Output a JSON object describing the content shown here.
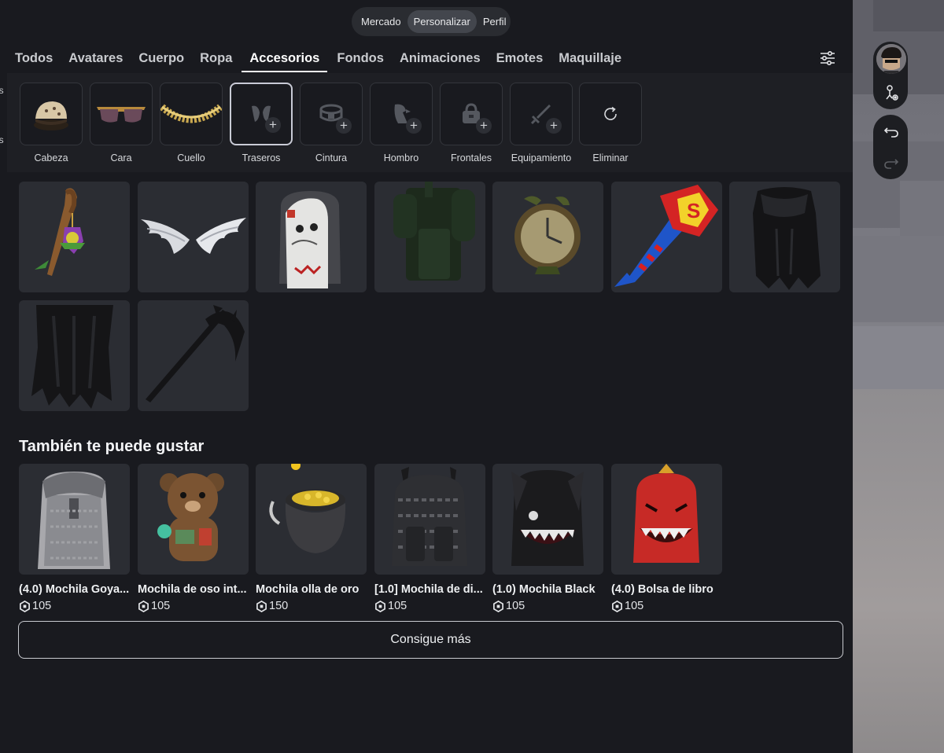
{
  "top_switch": {
    "items": [
      "Mercado",
      "Personalizar",
      "Perfil"
    ],
    "active": "Personalizar"
  },
  "tabs": [
    "Todos",
    "Avatares",
    "Cuerpo",
    "Ropa",
    "Accesorios",
    "Fondos",
    "Animaciones",
    "Emotes",
    "Maquillaje"
  ],
  "active_tab": "Accesorios",
  "left_clip": [
    "os",
    "as"
  ],
  "subcategories": [
    {
      "label": "Cabeza",
      "icon": "cap-icon"
    },
    {
      "label": "Cara",
      "icon": "sunglasses-icon"
    },
    {
      "label": "Cuello",
      "icon": "chain-icon"
    },
    {
      "label": "Traseros",
      "icon": "wings-icon",
      "active": true
    },
    {
      "label": "Cintura",
      "icon": "belt-icon"
    },
    {
      "label": "Hombro",
      "icon": "parrot-icon"
    },
    {
      "label": "Frontales",
      "icon": "bag-icon"
    },
    {
      "label": "Equipamiento",
      "icon": "sword-icon"
    },
    {
      "label": "Eliminar",
      "icon": "refresh-icon"
    }
  ],
  "owned_items": [
    {
      "icon": "lantern-staff-icon"
    },
    {
      "icon": "white-wings-icon"
    },
    {
      "icon": "sprayground-backpack-icon"
    },
    {
      "icon": "green-backpack-icon"
    },
    {
      "icon": "clock-icon"
    },
    {
      "icon": "superman-hammer-icon"
    },
    {
      "icon": "black-cape-icon"
    },
    {
      "icon": "tattered-cloak-icon"
    },
    {
      "icon": "scythe-icon"
    }
  ],
  "recommendations_title": "También te puede gustar",
  "recommendations": [
    {
      "name": "(4.0) Mochila Goya...",
      "price": "105",
      "icon": "gray-backpack-icon"
    },
    {
      "name": "Mochila de oso int...",
      "price": "105",
      "icon": "bear-backpack-icon"
    },
    {
      "name": "Mochila olla de oro",
      "price": "150",
      "icon": "gold-pot-icon"
    },
    {
      "name": "[1.0] Mochila de di...",
      "price": "105",
      "icon": "monogram-backpack-icon"
    },
    {
      "name": "(1.0) Mochila Black",
      "price": "105",
      "icon": "shark-backpack-icon"
    },
    {
      "name": "(4.0) Bolsa de libro",
      "price": "105",
      "icon": "red-shark-backpack-icon"
    }
  ],
  "more_button": "Consigue más",
  "colors": {
    "background": "#191a1f",
    "tile": "#2b2d33",
    "text": "#f0f1f3",
    "accent_border": "#c9cbd6"
  }
}
